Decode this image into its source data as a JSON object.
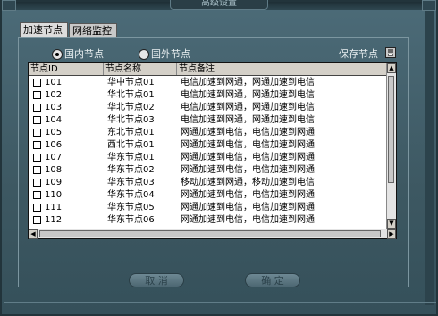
{
  "window": {
    "title": "高级设置"
  },
  "tabs": [
    {
      "label": "加速节点",
      "active": true
    },
    {
      "label": "网络监控",
      "active": false
    }
  ],
  "radio": {
    "domestic_label": "国内节点",
    "foreign_label": "国外节点",
    "selected": "domestic"
  },
  "save": {
    "label": "保存节点"
  },
  "table": {
    "headers": [
      "节点ID",
      "节点名称",
      "节点备注"
    ],
    "rows": [
      {
        "id": "101",
        "name": "华中节点01",
        "note": "电信加速到网通，网通加速到电信",
        "checked": false
      },
      {
        "id": "102",
        "name": "华北节点01",
        "note": "电信加速到网通，网通加速到电信",
        "checked": false
      },
      {
        "id": "103",
        "name": "华北节点02",
        "note": "电信加速到网通，网通加速到电信",
        "checked": false
      },
      {
        "id": "104",
        "name": "华北节点03",
        "note": "电信加速到网通，网通加速到电信",
        "checked": false
      },
      {
        "id": "105",
        "name": "东北节点01",
        "note": "网通加速到电信，电信加速到网通",
        "checked": false
      },
      {
        "id": "106",
        "name": "西北节点01",
        "note": "网通加速到电信，电信加速到网通",
        "checked": false
      },
      {
        "id": "107",
        "name": "华东节点01",
        "note": "网通加速到电信，电信加速到网通",
        "checked": false
      },
      {
        "id": "108",
        "name": "华东节点02",
        "note": "网通加速到电信，电信加速到网通",
        "checked": false
      },
      {
        "id": "109",
        "name": "华东节点03",
        "note": "移动加速到网通，移动加速到电信",
        "checked": false
      },
      {
        "id": "110",
        "name": "华东节点04",
        "note": "网通加速到电信，电信加速到网通",
        "checked": false
      },
      {
        "id": "111",
        "name": "华东节点05",
        "note": "网通加速到电信，电信加速到网通",
        "checked": false
      },
      {
        "id": "112",
        "name": "华东节点06",
        "note": "网通加速到电信，电信加速到网通",
        "checked": false
      }
    ]
  },
  "buttons": {
    "cancel": "取 消",
    "ok": "确 定"
  },
  "colors": {
    "background": "#3f5a66",
    "table_bg": "#ffffff",
    "header_bg": "#d4d0c8"
  }
}
